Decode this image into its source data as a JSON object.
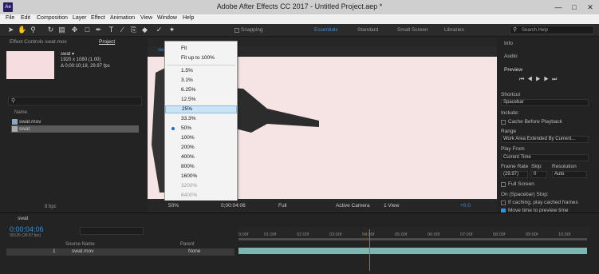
{
  "window": {
    "title": "Adobe After Effects CC 2017 - Untitled Project.aep *",
    "app_icon": "Ae"
  },
  "menu": [
    "File",
    "Edit",
    "Composition",
    "Layer",
    "Effect",
    "Animation",
    "View",
    "Window",
    "Help"
  ],
  "toolbar": {
    "snapping": "Snapping",
    "workspaces": [
      "Essentials",
      "Standard",
      "Small Screen",
      "Libraries"
    ],
    "search_placeholder": "Search Help"
  },
  "project_panel": {
    "tab_effect_controls": "Effect Controls swat.mov",
    "tab_project": "Project",
    "footage": {
      "name": "swat ▾",
      "res": "1920 x 1080 (1.00)",
      "duration": "Δ 0;00:10;18, 29.97 fps"
    },
    "column_name": "Name",
    "items": [
      "swat.mov",
      "swat"
    ],
    "bpc": "8 bpc"
  },
  "comp_viewer": {
    "tab": "swat",
    "zoom": "50%",
    "timecode": "0;00:04:06",
    "resolution": "Full",
    "camera": "Active Camera",
    "view": "1 View",
    "exposure": "+0.0"
  },
  "zoom_menu": {
    "fit": "Fit",
    "fit_up": "Fit up to 100%",
    "options": [
      "1.5%",
      "3.1%",
      "6.25%",
      "12.5%",
      "25%",
      "33.3%",
      "50%",
      "100%",
      "200%",
      "400%",
      "800%",
      "1600%",
      "3200%",
      "6400%"
    ],
    "highlighted": "25%",
    "checked": "50%"
  },
  "right_panel": {
    "info": "Info",
    "audio": "Audio",
    "preview": "Preview",
    "shortcut_label": "Shortcut",
    "shortcut_value": "Spacebar",
    "include": "Include:",
    "cache": "Cache Before Playback",
    "range_label": "Range",
    "range_value": "Work Area Extended By Current...",
    "playfrom_label": "Play From",
    "playfrom_value": "Current Time",
    "framerate": "Frame Rate",
    "skip": "Skip",
    "resolution": "Resolution",
    "fr_value": "(29.97)",
    "skip_value": "0",
    "res_value": "Auto",
    "fullscreen": "Full Screen",
    "onstop": "On (Spacebar) Stop:",
    "ifcaching": "If caching, play cached frames",
    "movetime": "Move time to preview time"
  },
  "timeline": {
    "tab": "swat",
    "timecode": "0:00:04:06",
    "fps_note": "00126 (29.97 fps)",
    "col_source": "Source Name",
    "col_parent": "Parent",
    "layer_num": "1",
    "layer_name": "swat.mov",
    "parent_value": "None",
    "ticks": [
      "0:00f",
      "01:00f",
      "02:00f",
      "03:00f",
      "04:00f",
      "05:00f",
      "06:00f",
      "07:00f",
      "08:00f",
      "09:00f",
      "10:00f"
    ]
  }
}
